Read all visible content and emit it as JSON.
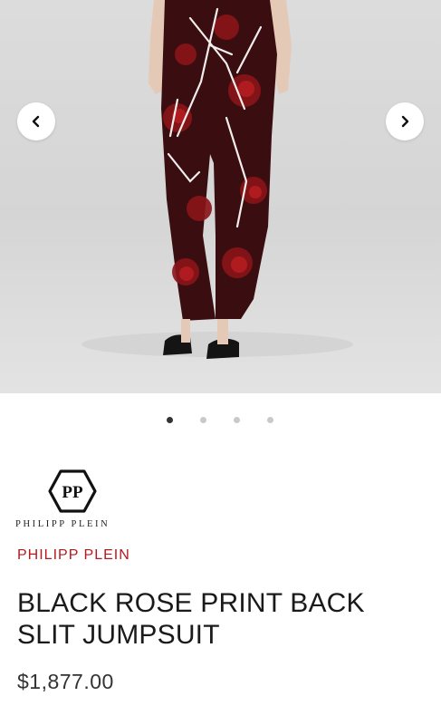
{
  "carousel": {
    "prev_icon": "chevron-left-icon",
    "next_icon": "chevron-right-icon",
    "dots_total": 4,
    "active_dot_index": 0
  },
  "logo": {
    "monogram": "PP",
    "wordmark": "PHILIPP PLEIN"
  },
  "product": {
    "brand": "PHILIPP PLEIN",
    "title": "BLACK ROSE PRINT BACK SLIT JUMPSUIT",
    "price": "$1,877.00"
  },
  "colors": {
    "brand_accent": "#b3191f",
    "text": "#1a1a1a",
    "dot_active": "#333333",
    "dot_inactive": "#c9c9c9"
  }
}
